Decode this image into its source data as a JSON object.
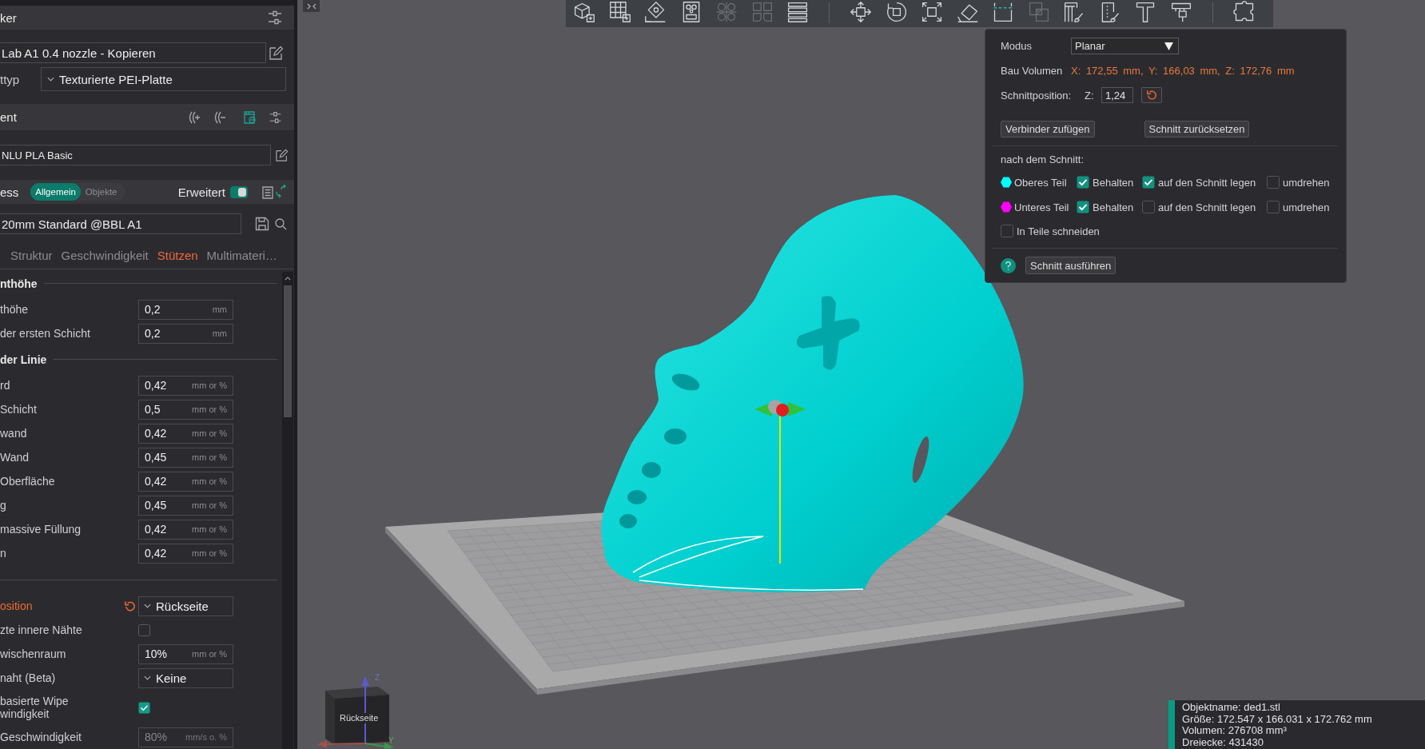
{
  "sidebar": {
    "printer": {
      "title": "ker",
      "preset": "Lab A1 0.4 nozzle - Kopieren",
      "plate_label": "ttyp",
      "plate_type": "Texturierte PEI-Platte"
    },
    "filament": {
      "title": "ent",
      "preset": "NLU PLA Basic"
    },
    "process": {
      "title": "ess",
      "scope_tabs": [
        {
          "label": "Allgemein",
          "selected": true
        },
        {
          "label": "Objekte",
          "selected": false
        }
      ],
      "advanced_label": "Erweitert",
      "advanced_on": true,
      "preset": "20mm Standard @BBL A1"
    },
    "tabs": [
      {
        "label": "Struktur",
        "selected": false,
        "modified": false
      },
      {
        "label": "Geschwindigkeit",
        "selected": false,
        "modified": false
      },
      {
        "label": "Stützen",
        "selected": false,
        "modified": true
      },
      {
        "label": "Multimateri…",
        "selected": false,
        "modified": false
      }
    ],
    "settings_groups": [
      {
        "title": "nthöhe",
        "settings": [
          {
            "kind": "number",
            "label": "thöhe",
            "value": "0,2",
            "unit": "mm",
            "modified": false,
            "disabled": false
          },
          {
            "kind": "number",
            "label": "der ersten Schicht",
            "value": "0,2",
            "unit": "mm",
            "modified": false,
            "disabled": false
          }
        ]
      },
      {
        "title": "der Linie",
        "settings": [
          {
            "kind": "number",
            "label": "rd",
            "value": "0,42",
            "unit": "mm or %",
            "modified": false,
            "disabled": false
          },
          {
            "kind": "number",
            "label": "Schicht",
            "value": "0,5",
            "unit": "mm or %",
            "modified": false,
            "disabled": false
          },
          {
            "kind": "number",
            "label": "wand",
            "value": "0,42",
            "unit": "mm or %",
            "modified": false,
            "disabled": false
          },
          {
            "kind": "number",
            "label": "Wand",
            "value": "0,45",
            "unit": "mm or %",
            "modified": false,
            "disabled": false
          },
          {
            "kind": "number",
            "label": "Oberfläche",
            "value": "0,42",
            "unit": "mm or %",
            "modified": false,
            "disabled": false
          },
          {
            "kind": "number",
            "label": "g",
            "value": "0,45",
            "unit": "mm or %",
            "modified": false,
            "disabled": false
          },
          {
            "kind": "number",
            "label": "massive Füllung",
            "value": "0,42",
            "unit": "mm or %",
            "modified": false,
            "disabled": false
          },
          {
            "kind": "number",
            "label": "n",
            "value": "0,42",
            "unit": "mm or %",
            "modified": false,
            "disabled": false
          }
        ]
      },
      {
        "settings": [
          {
            "kind": "dropdown",
            "label": "osition",
            "value": "Rückseite",
            "modified": true,
            "disabled": false
          },
          {
            "kind": "checkbox",
            "label": "zte innere Nähte",
            "checked": false,
            "modified": false,
            "disabled": false
          },
          {
            "kind": "number",
            "label": "wischenraum",
            "value": "10%",
            "unit": "mm or %",
            "modified": false,
            "disabled": false
          },
          {
            "kind": "dropdown",
            "label": "naht (Beta)",
            "value": "Keine",
            "modified": false,
            "disabled": false
          },
          {
            "kind": "checkbox",
            "label": "basierte Wipe windigkeit",
            "checked": true,
            "modified": false,
            "disabled": false
          },
          {
            "kind": "number",
            "label": "Geschwindigkeit",
            "value": "80%",
            "unit": "mm/s o. %",
            "modified": false,
            "disabled": true
          }
        ]
      }
    ]
  },
  "viewport": {
    "toolbar": {
      "groups": [
        {
          "tools": [
            {
              "kind": "cube",
              "selected": false,
              "disabled": false
            },
            {
              "kind": "grid",
              "selected": false,
              "disabled": false
            },
            {
              "kind": "diamond",
              "selected": false,
              "disabled": false
            },
            {
              "kind": "layout",
              "selected": false,
              "disabled": false
            },
            {
              "kind": "circles",
              "selected": false,
              "disabled": true
            },
            {
              "kind": "split",
              "selected": false,
              "disabled": true
            },
            {
              "kind": "layers",
              "selected": false,
              "disabled": false
            }
          ]
        },
        {
          "tools": [
            {
              "kind": "move",
              "selected": false,
              "disabled": false
            },
            {
              "kind": "rotate",
              "selected": false,
              "disabled": false
            },
            {
              "kind": "scale",
              "selected": false,
              "disabled": false
            },
            {
              "kind": "tilt",
              "selected": false,
              "disabled": false
            },
            {
              "kind": "cut",
              "selected": true,
              "disabled": false
            },
            {
              "kind": "overlap",
              "selected": false,
              "disabled": true
            },
            {
              "kind": "supports",
              "selected": false,
              "disabled": false
            },
            {
              "kind": "seam",
              "selected": false,
              "disabled": false
            },
            {
              "kind": "text",
              "selected": false,
              "disabled": false
            },
            {
              "kind": "measure",
              "selected": false,
              "disabled": false
            }
          ]
        },
        {
          "tools": [
            {
              "kind": "assembly",
              "selected": false,
              "disabled": false
            }
          ]
        }
      ]
    },
    "cut_dialog": {
      "mode_label": "Modus",
      "mode_value": "Planar",
      "volume_label": "Bau Volumen",
      "volume_value": "X: 172,55 mm, Y: 166,03 mm, Z: 172,76 mm",
      "position_label": "Schnittposition:",
      "axis_label": "Z:",
      "position_value": "1,24",
      "buttons": [
        "Verbinder zufügen",
        "Schnitt zurücksetzen"
      ],
      "after_cut_label": "nach dem Schnitt:",
      "parts": [
        {
          "name": "Oberes Teil",
          "color": "#00ffff",
          "options": [
            {
              "label": "Behalten",
              "checked": true
            },
            {
              "label": "auf den Schnitt legen",
              "checked": true
            },
            {
              "label": "umdrehen",
              "checked": false
            }
          ]
        },
        {
          "name": "Unteres Teil",
          "color": "#ff00ff",
          "options": [
            {
              "label": "Behalten",
              "checked": true
            },
            {
              "label": "auf den Schnitt legen",
              "checked": false
            },
            {
              "label": "umdrehen",
              "checked": false
            }
          ]
        }
      ],
      "split_option": {
        "label": "In Teile schneiden",
        "checked": false
      },
      "execute_button": "Schnitt ausführen"
    },
    "view_cube": {
      "face_label": "Rückseite",
      "axis_labels": [
        "Z",
        "Y"
      ]
    },
    "object_info": {
      "lines": [
        "Objektname: ded1.stl",
        "Größe: 172.547 x 166.031 x 172.762 mm",
        "Volumen: 276708 mm³",
        "Dreiecke: 431430"
      ]
    }
  }
}
